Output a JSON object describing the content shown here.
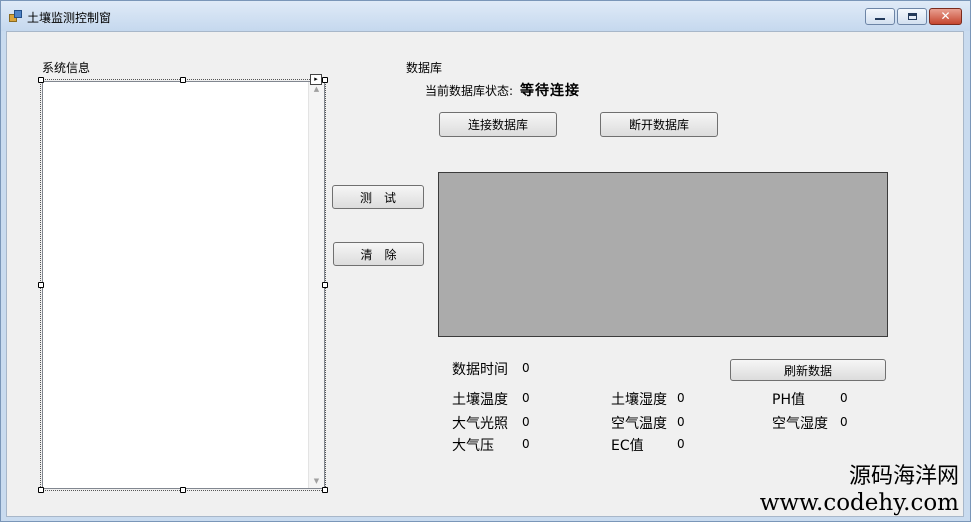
{
  "window": {
    "title": "土壤监测控制窗",
    "minimize_icon": "minimize-icon",
    "maximize_icon": "maximize-icon",
    "close_icon": "close-icon",
    "close_glyph": "✕"
  },
  "system_info": {
    "label": "系统信息",
    "scroll_up": "▲",
    "scroll_down": "▼",
    "smart_tag": "▸"
  },
  "buttons": {
    "test": "测　试",
    "clear": "清　除",
    "connect_db": "连接数据库",
    "disconnect_db": "断开数据库",
    "refresh": "刷新数据"
  },
  "database": {
    "group_label": "数据库",
    "status_label": "当前数据库状态:",
    "status_value": "等待连接"
  },
  "readings": {
    "time": {
      "label": "数据时间",
      "value": "0"
    },
    "soil_temp": {
      "label": "土壤温度",
      "value": "0"
    },
    "soil_humidity": {
      "label": "土壤湿度",
      "value": "0"
    },
    "ph": {
      "label": "PH值",
      "value": "0"
    },
    "light": {
      "label": "大气光照",
      "value": "0"
    },
    "air_temp": {
      "label": "空气温度",
      "value": "0"
    },
    "air_humidity": {
      "label": "空气湿度",
      "value": "0"
    },
    "pressure": {
      "label": "大气压",
      "value": "0"
    },
    "ec": {
      "label": "EC值",
      "value": "0"
    }
  },
  "watermark": {
    "line1": "源码海洋网",
    "line2": "www.codehy.com"
  }
}
